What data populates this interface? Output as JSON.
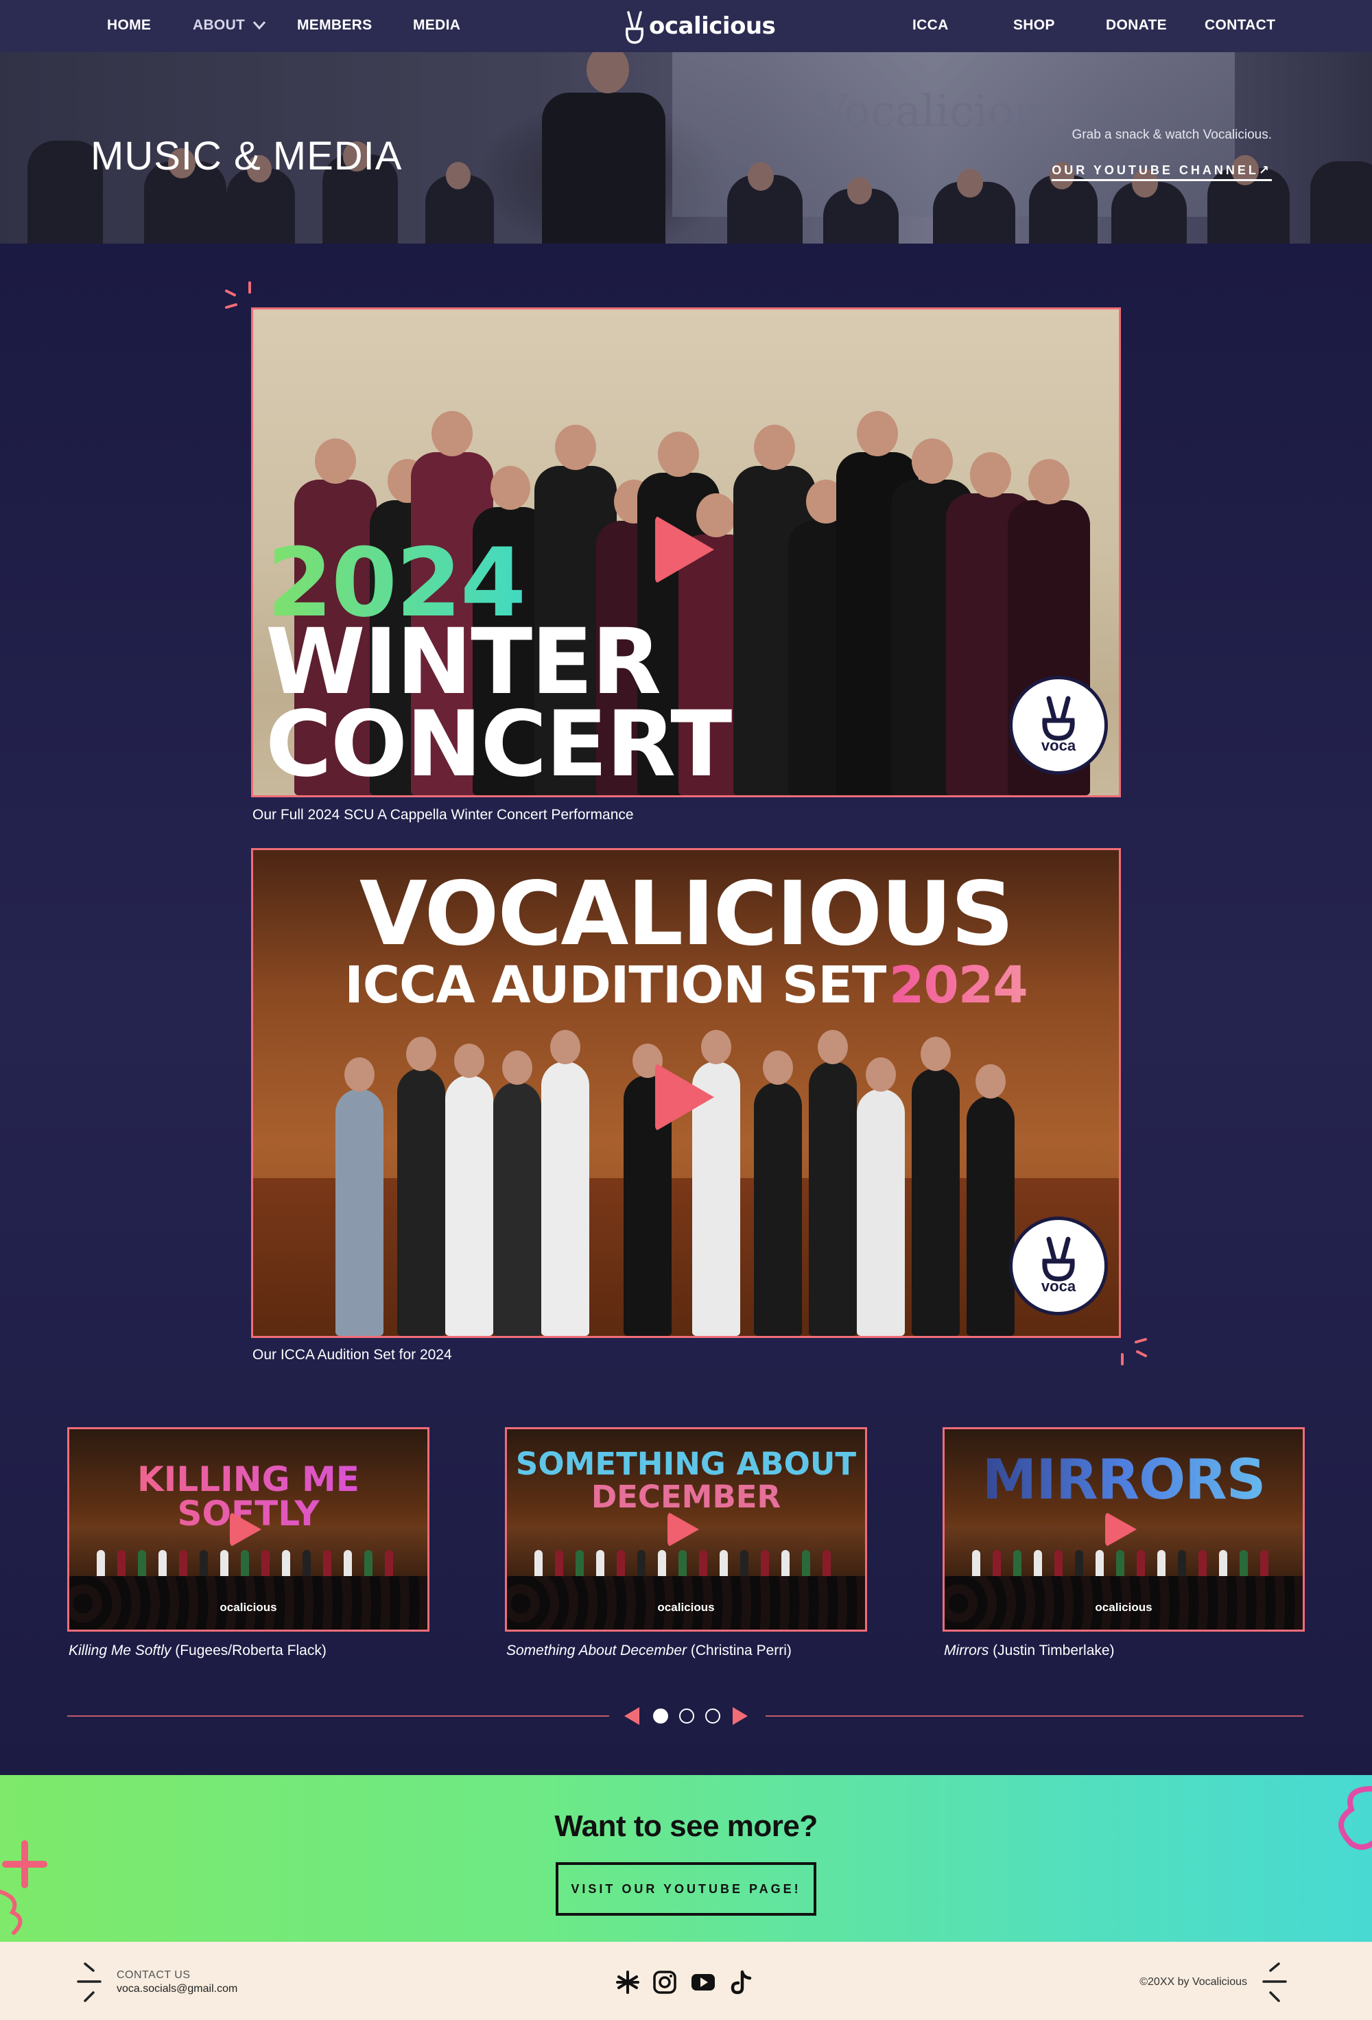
{
  "nav": {
    "home": "HOME",
    "about": "ABOUT",
    "members": "MEMBERS",
    "media": "MEDIA",
    "brand": "ocalicious",
    "icca": "ICCA",
    "shop": "SHOP",
    "donate": "DONATE",
    "contact": "CONTACT"
  },
  "hero": {
    "title": "MUSIC & MEDIA",
    "tagline": "Grab a snack & watch Vocalicious.",
    "link": "OUR YOUTUBE CHANNEL",
    "link_arrow": "↗",
    "backdrop_text": "Vocalicious"
  },
  "videos": [
    {
      "title_year": "2024",
      "title_line1": "WINTER",
      "title_line2": "CONCERT",
      "badge": "voca",
      "caption": "Our Full 2024 SCU A Cappella Winter Concert Performance"
    },
    {
      "title_line1": "VOCALICIOUS",
      "title_line2": "ICCA AUDITION SET",
      "title_year": "2024",
      "badge": "voca",
      "caption": "Our ICCA Audition Set for 2024"
    }
  ],
  "thumbnails": [
    {
      "title": "KILLING ME SOFTLY",
      "logo": "ocalicious",
      "song": "Killing Me Softly",
      "artist": " (Fugees/Roberta Flack)"
    },
    {
      "title_line1": "SOMETHING ABOUT",
      "title_line2": "DECEMBER",
      "logo": "ocalicious",
      "song": "Something About December",
      "artist": " (Christina Perri)"
    },
    {
      "title": "MIRRORS",
      "logo": "ocalicious",
      "song": "Mirrors",
      "artist": " (Justin Timberlake)"
    }
  ],
  "slider": {
    "pages": 3,
    "active": 1
  },
  "cta": {
    "title": "Want to see more?",
    "button": "VISIT OUR YOUTUBE PAGE!"
  },
  "footer": {
    "contact_label": "CONTACT US",
    "email": "voca.socials@gmail.com",
    "copyright": "©20XX by Vocalicious",
    "social_icons": [
      "linktree-icon",
      "instagram-icon",
      "youtube-icon",
      "tiktok-icon"
    ]
  },
  "colors": {
    "accent": "#f06d78",
    "nav_bg": "#2c2c52",
    "page_bg": "#1c1a40",
    "cta_green": "#7ee96a",
    "cta_teal": "#48d9d2",
    "footer_bg": "#f8ede0"
  }
}
